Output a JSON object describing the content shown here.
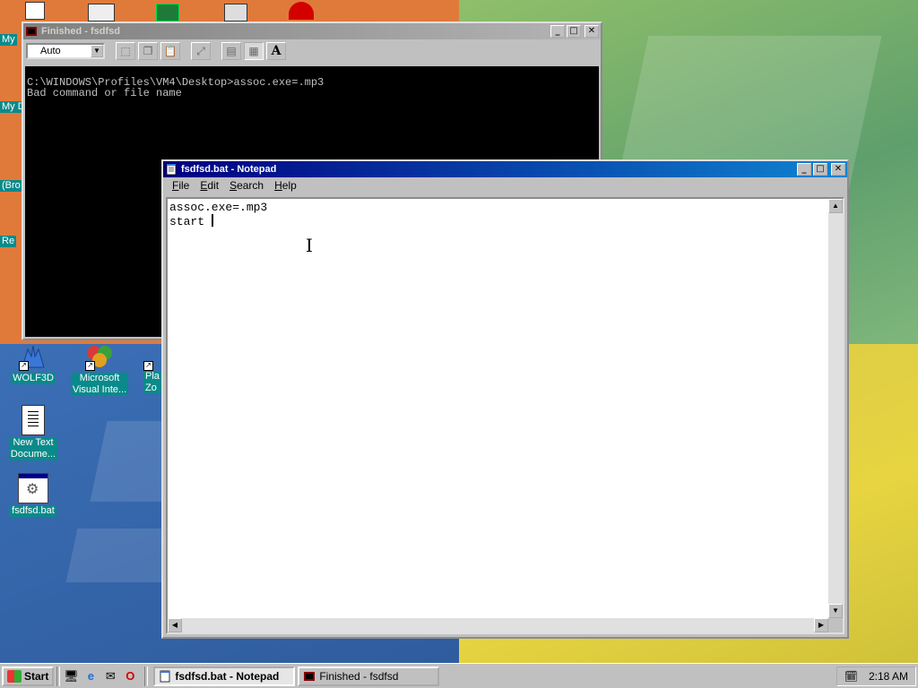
{
  "desktop": {
    "edge_labels": [
      "My",
      "My D",
      "(Bro",
      "Re"
    ],
    "icons": [
      {
        "label_1": "WOLF3D",
        "label_2": ""
      },
      {
        "label_1": "Microsoft",
        "label_2": "Visual Inte..."
      },
      {
        "label_1": "Pla",
        "label_2": "Zo"
      },
      {
        "label_1": "New Text",
        "label_2": "Docume..."
      },
      {
        "label_1": "fsdfsd.bat",
        "label_2": ""
      }
    ]
  },
  "dos_window": {
    "title": "Finished - fsdfsd",
    "font_combo": "Auto",
    "toolbar_font_label": "A",
    "output_lines": [
      "C:\\WINDOWS\\Profiles\\VM4\\Desktop>assoc.exe=.mp3",
      "Bad command or file name"
    ]
  },
  "notepad": {
    "title": "fsdfsd.bat - Notepad",
    "menu": [
      {
        "key": "F",
        "rest": "ile"
      },
      {
        "key": "E",
        "rest": "dit"
      },
      {
        "key": "S",
        "rest": "earch"
      },
      {
        "key": "H",
        "rest": "elp"
      }
    ],
    "lines": [
      "assoc.exe=.mp3",
      "start "
    ]
  },
  "window_buttons": {
    "minimize": "_",
    "maximize": "□",
    "close": "✕"
  },
  "taskbar": {
    "start_label": "Start",
    "tasks": [
      {
        "label": "fsdfsd.bat - Notepad",
        "active": true
      },
      {
        "label": "Finished - fsdfsd",
        "active": false
      }
    ],
    "clock": "2:18 AM"
  },
  "colors": {
    "active_title": "#000080",
    "inactive_title": "#808080",
    "face": "#c0c0c0",
    "selection": "#0a8a8a"
  }
}
